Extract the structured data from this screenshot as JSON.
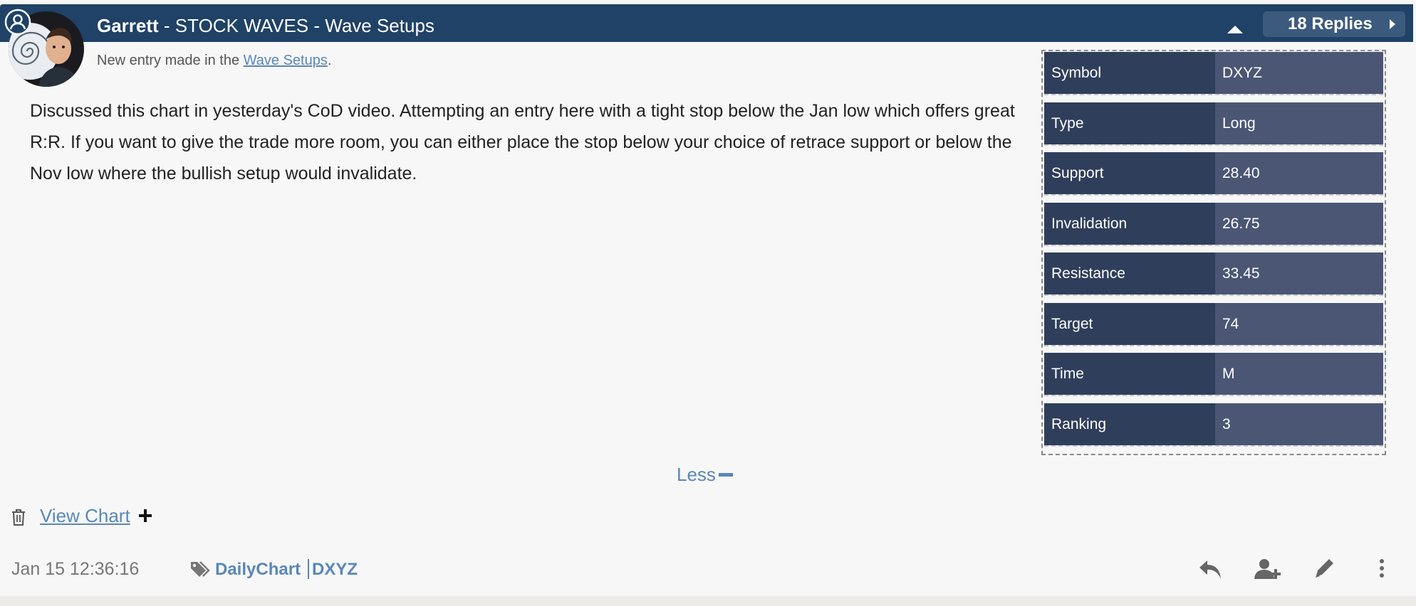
{
  "post": {
    "author": "Garrett",
    "title_rest": " - STOCK WAVES - Wave Setups",
    "replies_label": "18 Replies",
    "sub_prefix": "New entry made in the ",
    "sub_link": "Wave Setups",
    "sub_suffix": ".",
    "body": "Discussed this chart in yesterday's CoD video. Attempting an entry here with a tight stop below the Jan low which offers great R:R. If you want to give the trade more room, you can either place the stop below your choice of retrace support or below the Nov low where the bullish setup would invalidate."
  },
  "setup": {
    "rows": [
      {
        "label": "Symbol",
        "value": "DXYZ"
      },
      {
        "label": "Type",
        "value": "Long"
      },
      {
        "label": "Support",
        "value": "28.40"
      },
      {
        "label": "Invalidation",
        "value": "26.75"
      },
      {
        "label": "Resistance",
        "value": "33.45"
      },
      {
        "label": "Target",
        "value": "74"
      },
      {
        "label": "Time",
        "value": "M"
      },
      {
        "label": "Ranking",
        "value": "3"
      }
    ]
  },
  "controls": {
    "less_label": "Less",
    "view_chart_label": "View Chart"
  },
  "footer": {
    "timestamp": "Jan 15 12:36:16",
    "tags": [
      "DailyChart",
      "DXYZ"
    ]
  },
  "icons": {
    "user": "user-circle-icon",
    "caret": "caret-up-icon",
    "replies_arrow": "caret-right-icon",
    "trash": "trash-icon",
    "plus": "plus-icon",
    "tag": "tag-icon",
    "reply": "reply-icon",
    "follow": "add-user-icon",
    "edit": "pencil-icon",
    "more": "more-vertical-icon"
  },
  "colors": {
    "header": "#1f4266",
    "link": "#5b87b6",
    "table_label": "#2f3e5a",
    "table_value": "#4a5673"
  }
}
